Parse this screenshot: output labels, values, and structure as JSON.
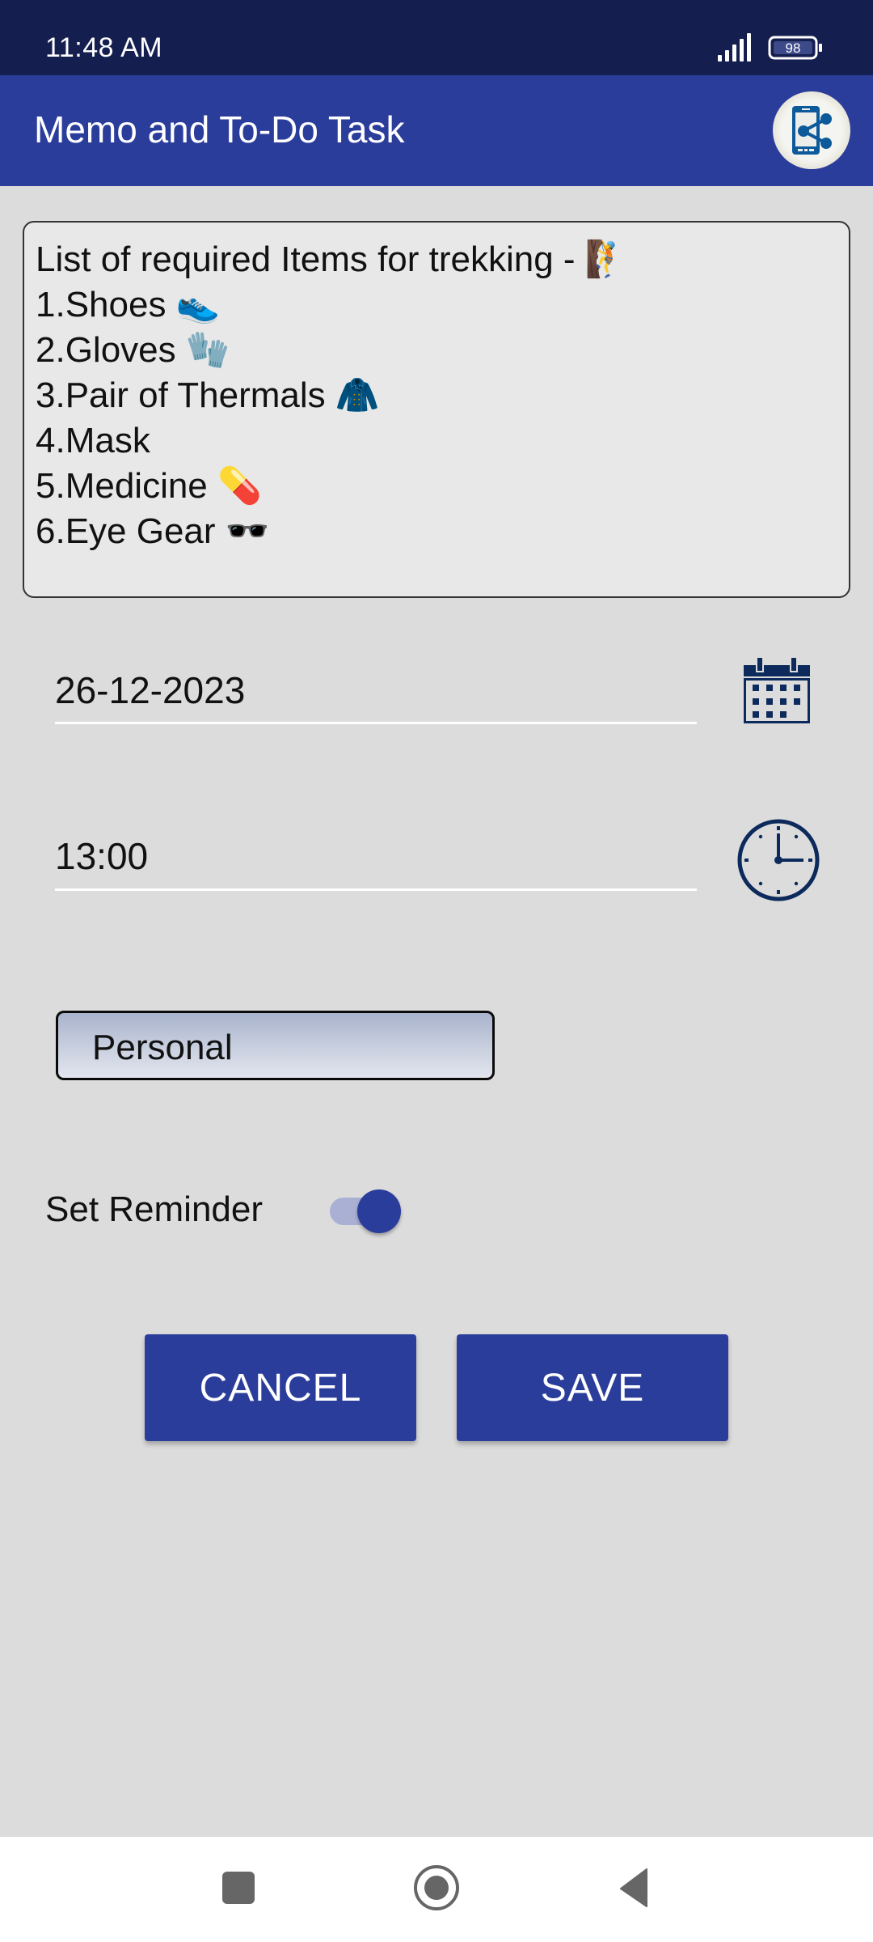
{
  "status_bar": {
    "time": "11:48 AM",
    "battery_level": "98",
    "icons": [
      "signal-icon",
      "battery-icon"
    ]
  },
  "app_bar": {
    "title": "Memo and To-Do Task",
    "share_icon": "share-icon"
  },
  "memo": {
    "lines": [
      "List of required Items for trekking - 🧗",
      "1.Shoes 👟",
      "2.Gloves 🧤",
      "3.Pair of Thermals 🧥",
      "4.Mask",
      "5.Medicine 💊",
      "6.Eye Gear 🕶️"
    ]
  },
  "date_field": {
    "value": "26-12-2023",
    "icon": "calendar-icon"
  },
  "time_field": {
    "value": "13:00",
    "icon": "clock-icon"
  },
  "category": {
    "selected": "Personal"
  },
  "reminder": {
    "label": "Set Reminder",
    "enabled": true
  },
  "actions": {
    "cancel_label": "CANCEL",
    "save_label": "SAVE"
  },
  "colors": {
    "status_bar": "#141E4F",
    "primary": "#2B3D9B",
    "background": "#DCDCDC",
    "icon_navy": "#0D2A5C"
  },
  "nav_bar": {
    "icons": [
      "recents-icon",
      "home-icon",
      "back-icon"
    ]
  }
}
